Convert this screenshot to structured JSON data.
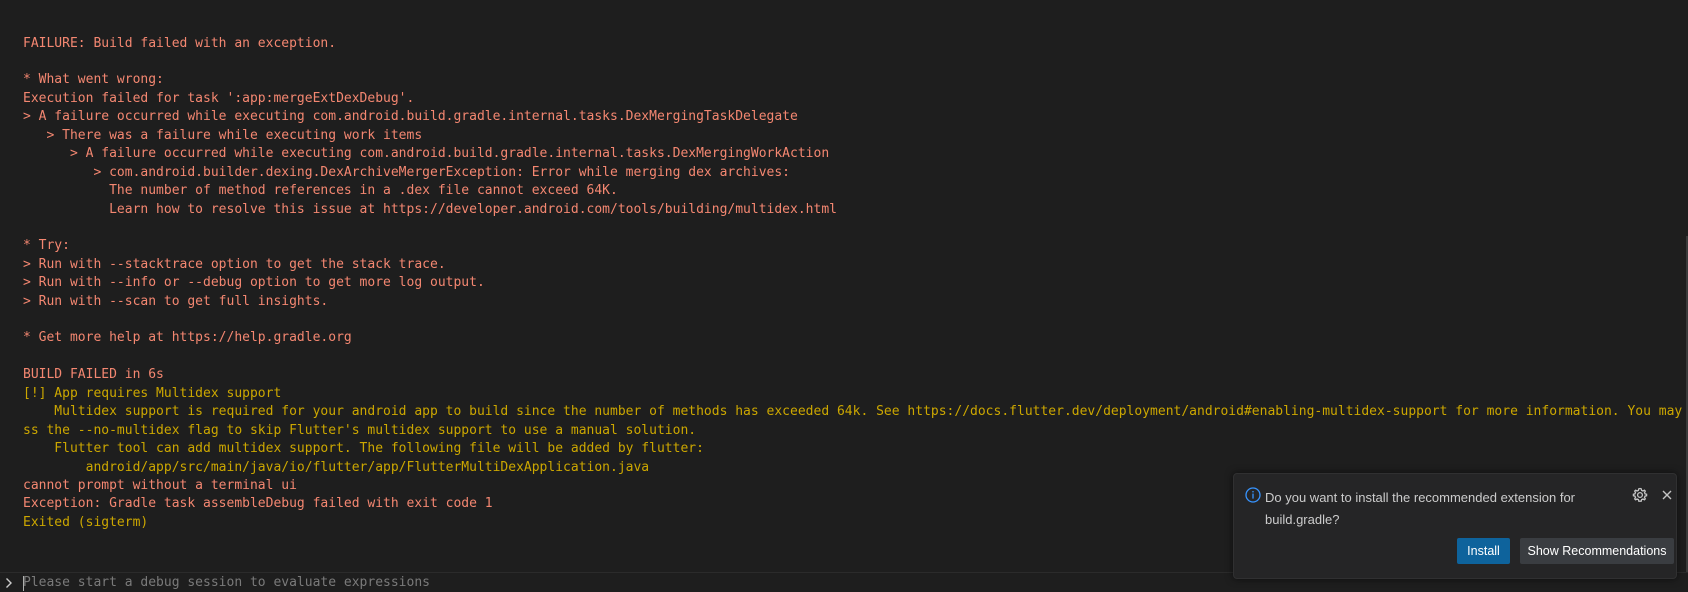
{
  "console": {
    "lines": [
      {
        "text": "FAILURE: Build failed with an exception.",
        "kind": "error"
      },
      {
        "text": "* What went wrong:",
        "kind": "error"
      },
      {
        "text": "Execution failed for task ':app:mergeExtDexDebug'.",
        "kind": "error"
      },
      {
        "text": "> A failure occurred while executing com.android.build.gradle.internal.tasks.DexMergingTaskDelegate",
        "kind": "error"
      },
      {
        "text": "   > There was a failure while executing work items",
        "kind": "error"
      },
      {
        "text": "      > A failure occurred while executing com.android.build.gradle.internal.tasks.DexMergingWorkAction",
        "kind": "error"
      },
      {
        "text": "         > com.android.builder.dexing.DexArchiveMergerException: Error while merging dex archives:",
        "kind": "error"
      },
      {
        "text": "           The number of method references in a .dex file cannot exceed 64K.",
        "kind": "error"
      },
      {
        "text": "           Learn how to resolve this issue at https://developer.android.com/tools/building/multidex.html",
        "kind": "error"
      },
      {
        "text": "* Try:",
        "kind": "error"
      },
      {
        "text": "> Run with --stacktrace option to get the stack trace.",
        "kind": "error"
      },
      {
        "text": "> Run with --info or --debug option to get more log output.",
        "kind": "error"
      },
      {
        "text": "> Run with --scan to get full insights.",
        "kind": "error"
      },
      {
        "text": "* Get more help at https://help.gradle.org",
        "kind": "error"
      },
      {
        "text": "BUILD FAILED in 6s",
        "kind": "error"
      },
      {
        "text": "[!] App requires Multidex support",
        "kind": "warning"
      },
      {
        "text": "    Multidex support is required for your android app to build since the number of methods has exceeded 64k. See https://docs.flutter.dev/deployment/android#enabling-multidex-support for more information. You may pa",
        "kind": "warning"
      },
      {
        "text": "ss the --no-multidex flag to skip Flutter's multidex support to use a manual solution.",
        "kind": "warning"
      },
      {
        "text": "    Flutter tool can add multidex support. The following file will be added by flutter:",
        "kind": "warning"
      },
      {
        "text": "        android/app/src/main/java/io/flutter/app/FlutterMultiDexApplication.java",
        "kind": "warning"
      },
      {
        "text": "cannot prompt without a terminal ui",
        "kind": "error"
      },
      {
        "text": "Exception: Gradle task assembleDebug failed with exit code 1",
        "kind": "error"
      },
      {
        "text": "Exited (sigterm)",
        "kind": "warning"
      }
    ]
  },
  "repl": {
    "placeholder": "Please start a debug session to evaluate expressions",
    "prompt_icon": "chevron-right-icon"
  },
  "notification": {
    "message": "Do you want to install the recommended extension for build.gradle?",
    "info_icon": "info-icon",
    "gear_icon": "gear-icon",
    "close_icon": "close-icon",
    "install_label": "Install",
    "show_recommendations_label": "Show Recommendations"
  },
  "colors": {
    "background": "#1e1e1e",
    "error_text": "#f48771",
    "warning_text": "#cca700",
    "primary_button": "#0e639c",
    "secondary_button": "#3a3d41",
    "info_icon": "#3794ff"
  }
}
